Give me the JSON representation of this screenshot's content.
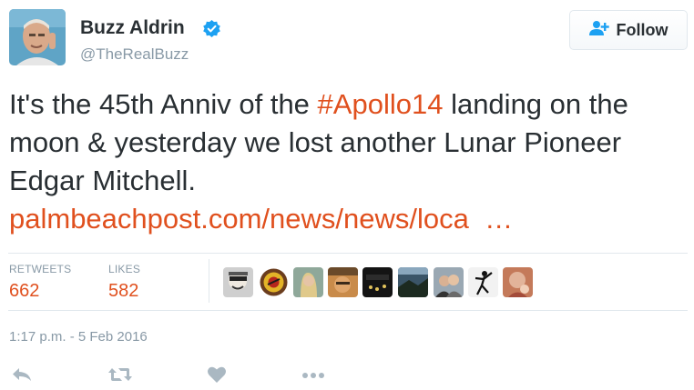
{
  "user": {
    "display_name": "Buzz Aldrin",
    "handle": "@TheRealBuzz",
    "verified": true
  },
  "follow_button": {
    "label": "Follow",
    "icon": "add-user-icon"
  },
  "tweet": {
    "text_part1": "It's the 45th Anniv of the ",
    "hashtag": "#Apollo14",
    "text_part2": " landing on the moon & yesterday we lost another Lunar Pioneer Edgar Mitchell. ",
    "link": "palmbeachpost.com/news/news/loca  …",
    "link_color": "#e0501e"
  },
  "stats": {
    "retweets_label": "RETWEETS",
    "retweets_value": "662",
    "likes_label": "LIKES",
    "likes_value": "582"
  },
  "liker_avatars": [
    "liker-avatar-1",
    "liker-avatar-2",
    "liker-avatar-3",
    "liker-avatar-4",
    "liker-avatar-5",
    "liker-avatar-6",
    "liker-avatar-7",
    "liker-avatar-8",
    "liker-avatar-9"
  ],
  "timestamp": "1:17 p.m. - 5 Feb 2016",
  "actions": [
    "reply-icon",
    "retweet-icon",
    "like-icon",
    "more-icon"
  ],
  "colors": {
    "accent": "#e0501e",
    "muted": "#8899a6",
    "verified": "#1da1f2"
  }
}
